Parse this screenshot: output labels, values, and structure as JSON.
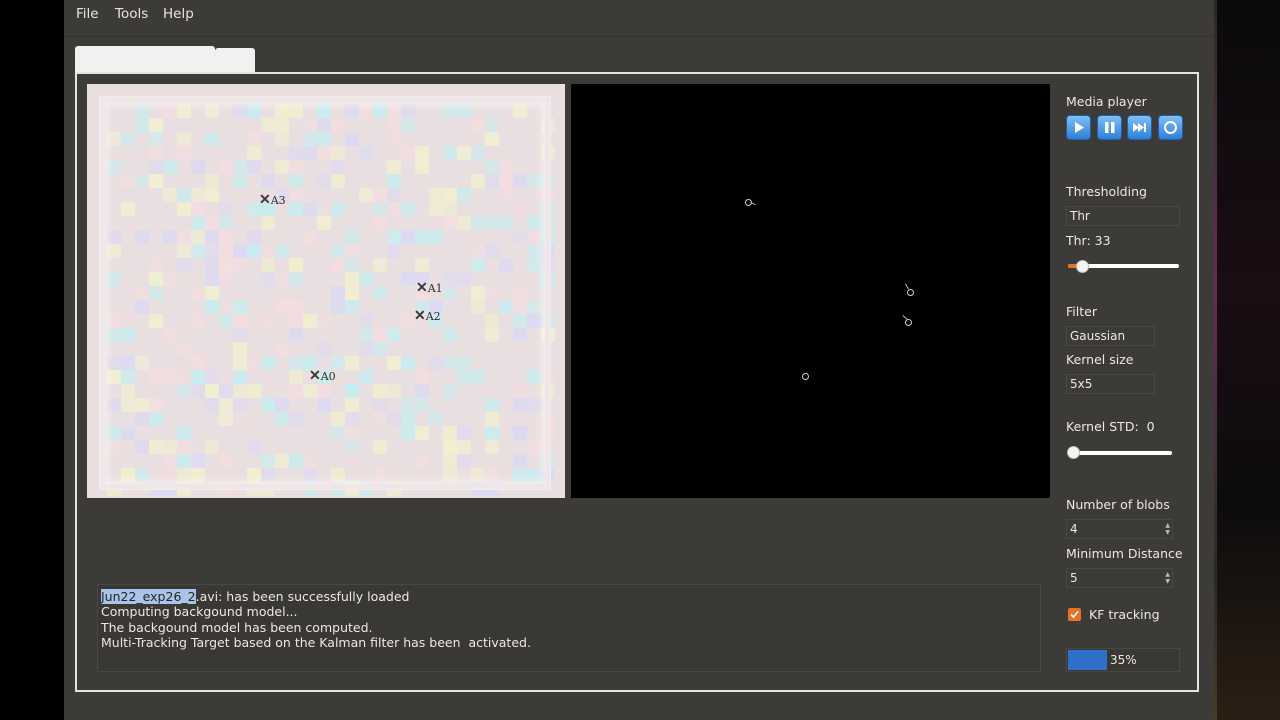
{
  "menu": {
    "file": "File",
    "tools": "Tools",
    "help": "Help"
  },
  "sidebar": {
    "media_player": "Media player",
    "media_buttons": [
      "play-icon",
      "pause-icon",
      "step-forward-icon",
      "stop-icon"
    ],
    "thresholding": "Thresholding",
    "threshold_method": "Thr",
    "threshold_label": "Thr: 33",
    "threshold_value": 33,
    "filter": "Filter",
    "filter_type": "Gaussian",
    "kernel_size_label": "Kernel size",
    "kernel_size": "5x5",
    "kernel_std_label": "Kernel STD:",
    "kernel_std": "0",
    "num_blobs_label": "Number of blobs",
    "num_blobs": "4",
    "min_distance_label": "Minimum Distance",
    "min_distance": "5",
    "kf_tracking": "KF tracking",
    "kf_checked": true,
    "progress_percent": 35,
    "progress_label": "35%"
  },
  "video": {
    "markers": [
      "A0",
      "A1",
      "A2",
      "A3"
    ]
  },
  "log": {
    "line1_highlight": "Jun22_exp26_2",
    "line1_rest": ".avi: has been successfully loaded",
    "line2": "Computing backgound model...",
    "line3": "The backgound model has been computed.",
    "line4": "Multi-Tracking Target based on the Kalman filter has been  activated."
  },
  "colors": {
    "accent": "#e8702a",
    "progress": "#2e6fc8",
    "highlight": "#a9c4e8"
  }
}
